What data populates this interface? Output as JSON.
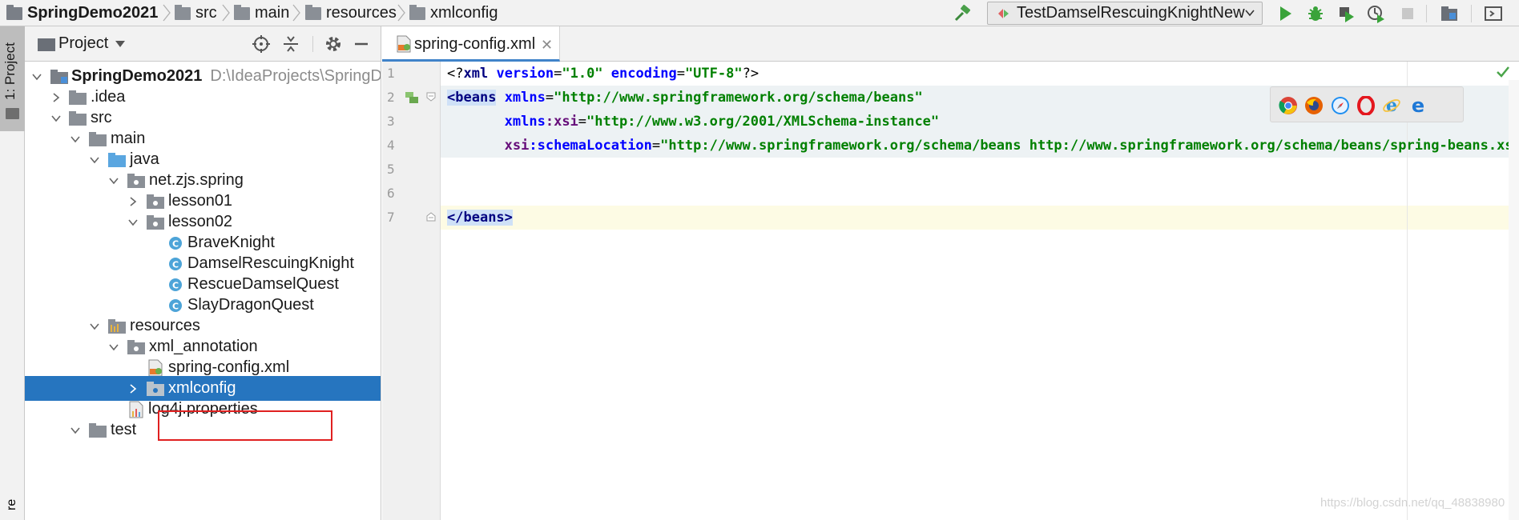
{
  "breadcrumb": {
    "project": "SpringDemo2021",
    "items": [
      "src",
      "main",
      "resources",
      "xmlconfig"
    ]
  },
  "toolbar": {
    "run_config": "TestDamselRescuingKnightNew",
    "icons": [
      "build-hammer-icon",
      "run-icon",
      "debug-icon",
      "coverage-icon",
      "profile-icon",
      "stop-icon",
      "project-structure-icon",
      "presentation-icon"
    ]
  },
  "tool_strip": {
    "project_tab": "1: Project",
    "structure_tab": "re"
  },
  "project_panel": {
    "title": "Project",
    "icons": [
      "locate-icon",
      "collapse-all-icon",
      "gear-icon",
      "hide-icon"
    ],
    "tree": [
      {
        "label": "SpringDemo2021",
        "path": "D:\\IdeaProjects\\SpringDe",
        "type": "module",
        "expanded": true
      },
      {
        "label": ".idea",
        "type": "folder",
        "expanded": false
      },
      {
        "label": "src",
        "type": "folder",
        "expanded": true
      },
      {
        "label": "main",
        "type": "folder",
        "expanded": true
      },
      {
        "label": "java",
        "type": "source-folder",
        "expanded": true
      },
      {
        "label": "net.zjs.spring",
        "type": "package",
        "expanded": true
      },
      {
        "label": "lesson01",
        "type": "package",
        "expanded": false
      },
      {
        "label": "lesson02",
        "type": "package",
        "expanded": true
      },
      {
        "label": "BraveKnight",
        "type": "class"
      },
      {
        "label": "DamselRescuingKnight",
        "type": "class"
      },
      {
        "label": "RescueDamselQuest",
        "type": "class"
      },
      {
        "label": "SlayDragonQuest",
        "type": "class"
      },
      {
        "label": "resources",
        "type": "resources-folder",
        "expanded": true
      },
      {
        "label": "xml_annotation",
        "type": "package",
        "expanded": true
      },
      {
        "label": "spring-config.xml",
        "type": "xml-file"
      },
      {
        "label": "xmlconfig",
        "type": "package",
        "expanded": false,
        "selected": true
      },
      {
        "label": "log4j.properties",
        "type": "properties-file"
      },
      {
        "label": "test",
        "type": "folder",
        "expanded": true
      }
    ]
  },
  "editor": {
    "tab": {
      "label": "spring-config.xml",
      "close": "✕"
    },
    "line_numbers": [
      "1",
      "2",
      "3",
      "4",
      "5",
      "6",
      "7"
    ],
    "code": {
      "l1_open": "<?",
      "l1_xml": "xml",
      "l1_version_attr": "version",
      "l1_version_val": "\"1.0\"",
      "l1_encoding_attr": "encoding",
      "l1_encoding_val": "\"UTF-8\"",
      "l1_close": "?>",
      "l2_lt": "<",
      "l2_tag": "beans",
      "l2_attr": "xmlns",
      "l2_val": "\"http://www.springframework.org/schema/beans\"",
      "l3_attr1": "xmlns",
      "l3_ns": ":xsi",
      "l3_val": "\"http://www.w3.org/2001/XMLSchema-instance\"",
      "l4_prefix": "xsi",
      "l4_attr": ":schemaLocation",
      "l4_val": "\"http://www.springframework.org/schema/beans http://www.springframework.org/schema/beans/spring-beans.xsd\"",
      "l4_close": ">",
      "l7_open": "</",
      "l7_tag": "beans",
      "l7_close": ">"
    },
    "browsers": [
      "chrome-icon",
      "firefox-icon",
      "safari-icon",
      "opera-icon",
      "ie-icon",
      "edge-icon"
    ]
  },
  "watermark": "https://blog.csdn.net/qq_48838980",
  "colors": {
    "selection": "#2675bf",
    "highlight_box": "#e02020",
    "xml_tag": "#000080",
    "xml_attr": "#0000ff",
    "xml_string": "#008000"
  }
}
